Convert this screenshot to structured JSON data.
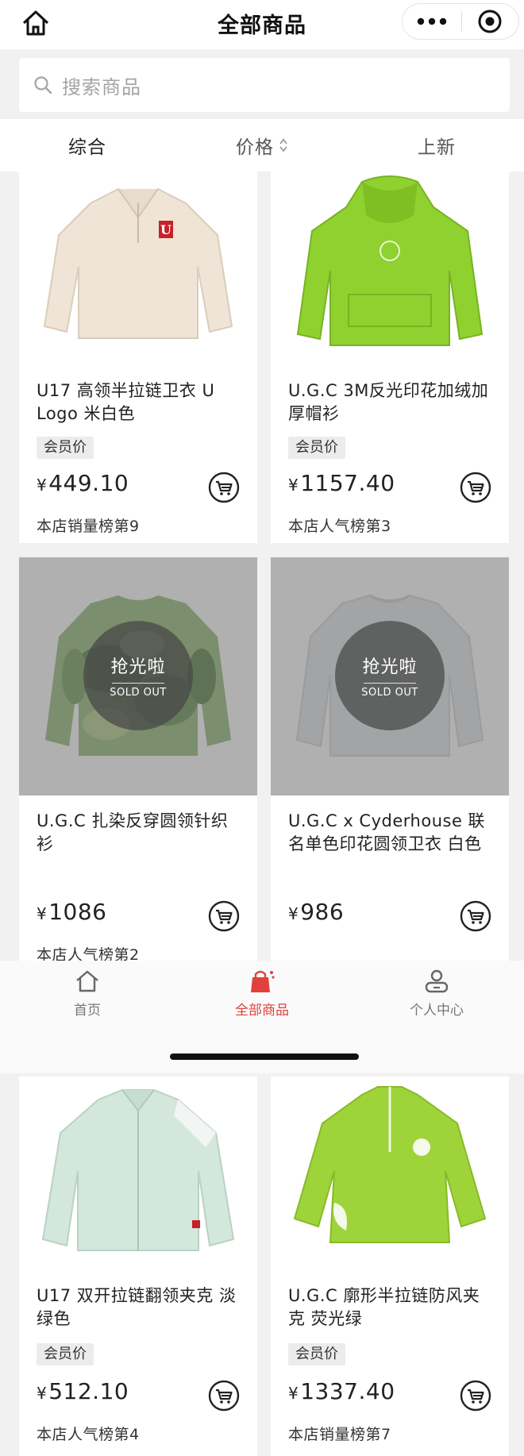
{
  "header": {
    "title": "全部商品",
    "home_icon": "home-icon",
    "more_icon": "more-dots-icon",
    "close_icon": "target-close-icon"
  },
  "search": {
    "placeholder": "搜索商品",
    "icon": "search-icon"
  },
  "sort_tabs": [
    {
      "label": "综合",
      "active": true
    },
    {
      "label": "价格",
      "sortable": true
    },
    {
      "label": "上新"
    }
  ],
  "products": [
    {
      "name": "U17 高领半拉链卫衣 U Logo 米白色",
      "tag": "会员价",
      "currency": "¥",
      "price": "449.10",
      "rank": "本店销量榜第9",
      "sold_out": false,
      "color": "#efe6da"
    },
    {
      "name": "U.G.C 3M反光印花加绒加厚帽衫",
      "tag": "会员价",
      "currency": "¥",
      "price": "1157.40",
      "rank": "本店人气榜第3",
      "sold_out": false,
      "color": "#8fd12f"
    },
    {
      "name": "U.G.C 扎染反穿圆领针织衫",
      "tag": "",
      "currency": "¥",
      "price": "1086",
      "rank": "本店人气榜第2",
      "sold_out": true,
      "color": "#6c9a4c"
    },
    {
      "name": "U.G.C x Cyderhouse 联名单色印花圆领卫衣 白色",
      "tag": "",
      "currency": "¥",
      "price": "986",
      "rank": "",
      "sold_out": true,
      "color": "#d6d8dc"
    },
    {
      "name": "U17 双开拉链翻领夹克 淡绿色",
      "tag": "会员价",
      "currency": "¥",
      "price": "512.10",
      "rank": "本店人气榜第4",
      "sold_out": false,
      "color": "#cfe3d9"
    },
    {
      "name": "U.G.C 廓形半拉链防风夹克 荧光绿",
      "tag": "会员价",
      "currency": "¥",
      "price": "1337.40",
      "rank": "本店销量榜第7",
      "sold_out": false,
      "color": "#9ed43a"
    }
  ],
  "sold_out_badge": {
    "cn": "抢光啦",
    "en": "SOLD OUT"
  },
  "bottom_nav": [
    {
      "label": "首页",
      "icon": "home-icon"
    },
    {
      "label": "全部商品",
      "icon": "shopping-bag-icon",
      "active": true
    },
    {
      "label": "个人中心",
      "icon": "profile-icon"
    }
  ],
  "colors": {
    "accent": "#e0413c",
    "background": "#f1f1f1",
    "card": "#ffffff"
  }
}
